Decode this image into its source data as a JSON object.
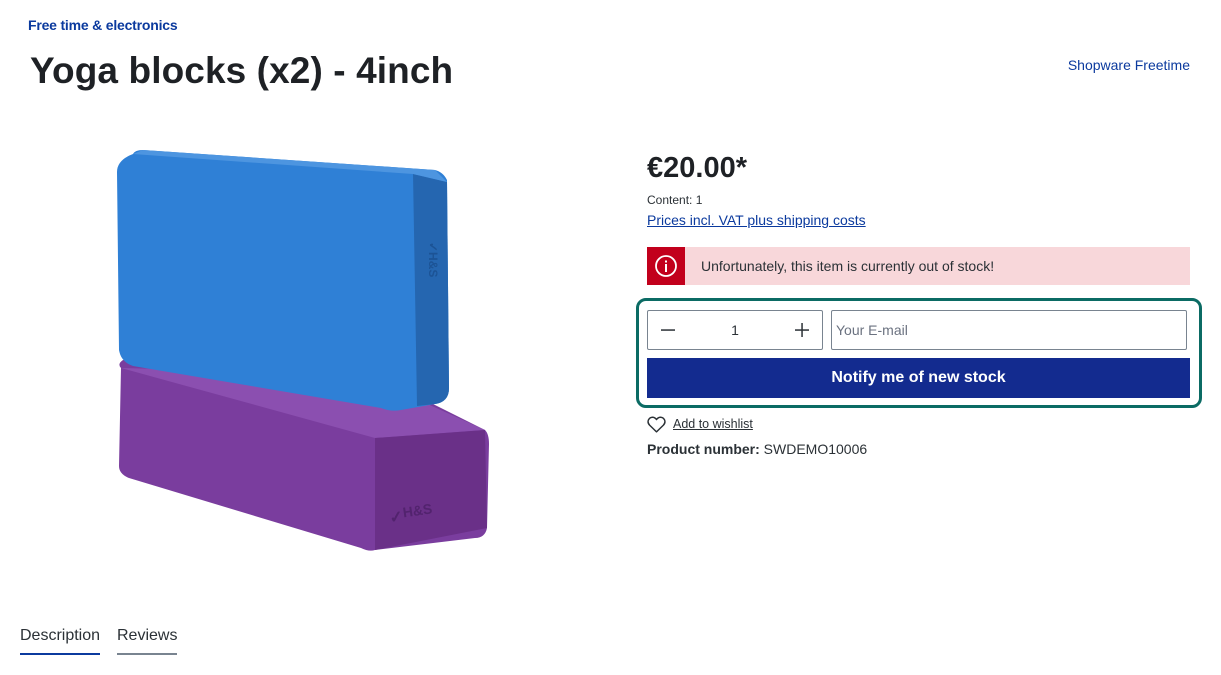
{
  "breadcrumb": {
    "category": "Free time & electronics"
  },
  "product": {
    "title": "Yoga blocks (x2) - 4inch",
    "manufacturer": "Shopware Freetime",
    "price": "€20.00*",
    "content": "Content: 1",
    "vat_link": "Prices incl. VAT plus shipping costs",
    "stock_alert": "Unfortunately, this item is currently out of stock!",
    "product_number_label": "Product number:",
    "product_number": "SWDEMO10006",
    "image_brand_mark": "H&S"
  },
  "buy_form": {
    "quantity": "1",
    "email_placeholder": "Your E-mail",
    "notify_label": "Notify me of new stock",
    "wishlist_label": "Add to wishlist"
  },
  "tabs": [
    {
      "label": "Description",
      "active": true
    },
    {
      "label": "Reviews",
      "active": false
    }
  ],
  "colors": {
    "brand_blue": "#0b3a9e",
    "button_blue": "#132b8f",
    "alert_bg": "#f8d7da",
    "alert_icon_bg": "#c2001c",
    "highlight_frame": "#0b6b64",
    "block_blue": "#2f80d6",
    "block_purple": "#7a3d9e"
  },
  "icons": [
    "info-icon",
    "minus-icon",
    "plus-icon",
    "heart-icon"
  ]
}
